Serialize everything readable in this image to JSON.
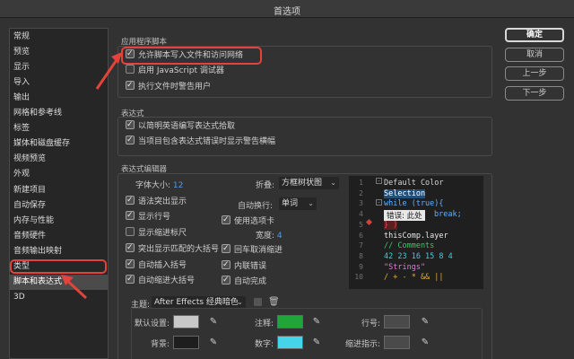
{
  "window": {
    "title": "首选项"
  },
  "sidebar": {
    "items": [
      "常规",
      "预览",
      "显示",
      "导入",
      "输出",
      "网格和参考线",
      "标签",
      "媒体和磁盘缓存",
      "视频预览",
      "外观",
      "新建项目",
      "自动保存",
      "内存与性能",
      "音频硬件",
      "音频输出映射",
      "类型",
      "脚本和表达式",
      "3D"
    ],
    "selected": "脚本和表达式"
  },
  "app_scripts": {
    "title": "应用程序脚本",
    "allow_scripts": "允许脚本写入文件和访问网络",
    "enable_debugger": "启用 JavaScript 调试器",
    "warn_exec": "执行文件时警告用户"
  },
  "expressions": {
    "title": "表达式",
    "pickwhip_english": "以简明英语编写表达式拾取",
    "project_warning": "当项目包含表达式错误时显示警告横幅"
  },
  "editor": {
    "title": "表达式编辑器",
    "font_size_label": "字体大小:",
    "font_size_value": "12",
    "fold_label": "折叠:",
    "fold_value": "方框树状图",
    "syntax_highlight": "语法突出显示",
    "auto_wrap_label": "自动换行:",
    "auto_wrap_value": "单词",
    "show_line_numbers": "显示行号",
    "use_tabs": "使用选项卡",
    "show_indent_ruler": "显示缩进标尺",
    "width_label": "宽度:",
    "width_value": "4",
    "highlight_brackets": "突出显示匹配的大括号",
    "cr_cancel_indent": "回车取消缩进",
    "auto_insert_brackets": "自动插入括号",
    "inline_errors": "内联错误",
    "auto_indent_braces": "自动缩进大括号",
    "autocomplete": "自动完成"
  },
  "code_preview": {
    "lines": [
      {
        "n": "1",
        "text": "Default Color",
        "color": "#d4d4d4"
      },
      {
        "n": "2",
        "text": "Selection",
        "color": "#5fb0ff"
      },
      {
        "n": "3",
        "text": "while (true){",
        "color": "#5fb0ff"
      },
      {
        "n": "4",
        "text": "break;",
        "color": "#5fb0ff"
      },
      {
        "n": "5",
        "text": "} )",
        "color": "#e05050"
      },
      {
        "n": "6",
        "text": "thisComp.layer",
        "color": "#e8e8e8"
      },
      {
        "n": "7",
        "text": "// Comments",
        "color": "#3ec46d"
      },
      {
        "n": "8",
        "text": "42 23 16 15 8 4",
        "color": "#45c9d9"
      },
      {
        "n": "9",
        "text": "\"Strings\"",
        "color": "#e27ad6"
      },
      {
        "n": "10",
        "text": "/ + - * && ||",
        "color": "#e0aa3a"
      }
    ],
    "error_label": "错误: 此处"
  },
  "theme": {
    "label": "主题:",
    "value": "After Effects 经典暗色",
    "rows": [
      [
        {
          "label": "默认设置:",
          "color": "#c8c8c8"
        },
        {
          "label": "注释:",
          "color": "#1fa53a"
        },
        {
          "label": "行号:",
          "color": "#4a4a4a"
        }
      ],
      [
        {
          "label": "背景:",
          "color": "#1e1e1e"
        },
        {
          "label": "数字:",
          "color": "#45d5ea"
        },
        {
          "label": "缩进指示:",
          "color": "#4a4a4a"
        }
      ]
    ]
  },
  "buttons": {
    "ok": "确定",
    "cancel": "取消",
    "prev": "上一步",
    "next": "下一步"
  },
  "colors": {
    "annotation": "#e3433a",
    "accent_blue": "#4f9be8"
  }
}
